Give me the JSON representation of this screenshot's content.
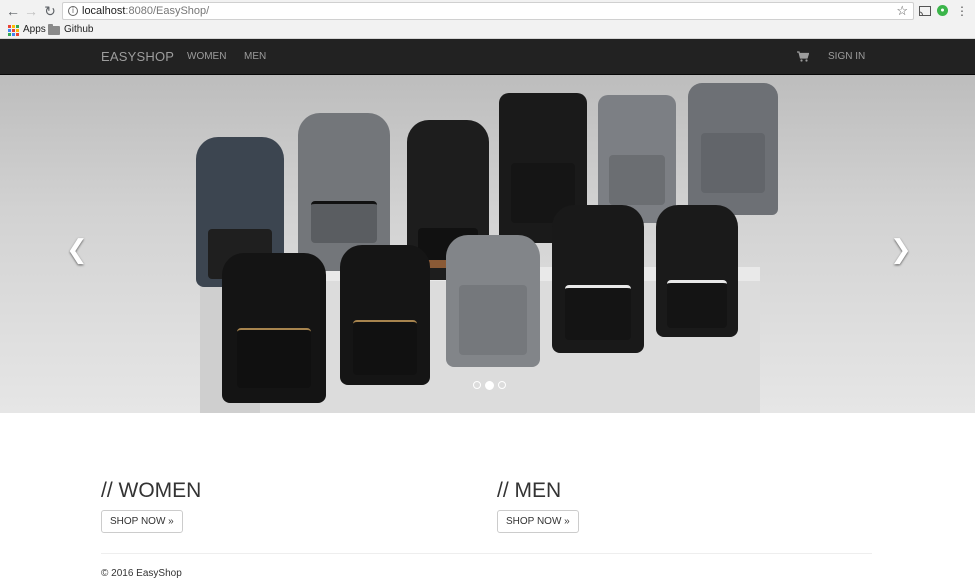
{
  "browser": {
    "url_host": "localhost",
    "url_path": ":8080/EasyShop/",
    "bookmarks": [
      {
        "label": "Apps",
        "icon": "apps-grid-icon"
      },
      {
        "label": "Github",
        "icon": "folder-icon"
      }
    ],
    "icons": {
      "back": "back-arrow-icon",
      "forward": "forward-arrow-icon",
      "reload": "reload-icon",
      "info": "info-icon",
      "star": "star-icon",
      "cast": "cast-icon",
      "extension": "green-extension-icon",
      "menu": "kebab-menu-icon"
    },
    "colors": {
      "chrome_bg": "#f2f2f2",
      "apps_dots": [
        "#ea4335",
        "#fbbc05",
        "#34a853",
        "#4285f4"
      ]
    }
  },
  "navbar": {
    "brand": "EASYSHOP",
    "links": [
      "WOMEN",
      "MEN"
    ],
    "cart_icon": "cart-icon",
    "signin": "SIGN IN",
    "colors": {
      "background": "#222222",
      "text": "#9d9d9d"
    }
  },
  "carousel": {
    "prev_icon": "chevron-left-icon",
    "next_icon": "chevron-right-icon",
    "prev_glyph": "❮",
    "next_glyph": "❯",
    "slide_count": 3,
    "active_index": 1
  },
  "sections": [
    {
      "title": "// WOMEN",
      "button": "SHOP NOW »"
    },
    {
      "title": "// MEN",
      "button": "SHOP NOW »"
    }
  ],
  "footer": {
    "text": "© 2016 EasyShop"
  }
}
